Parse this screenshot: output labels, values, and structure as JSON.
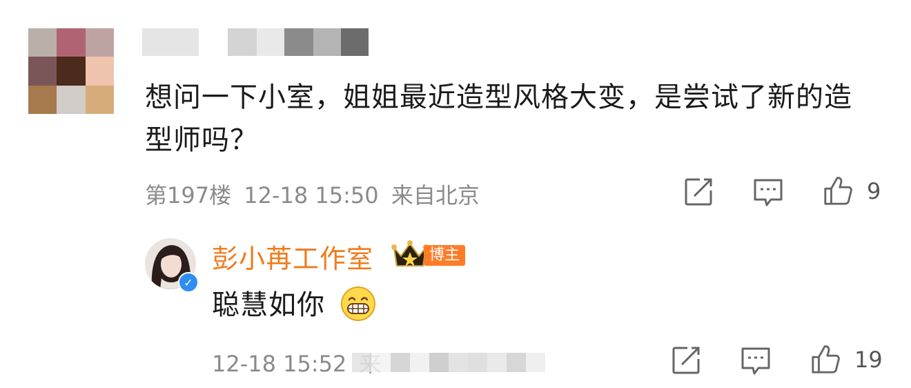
{
  "comment": {
    "text": "想问一下小室，姐姐最近造型风格大变，是尝试了新的造型师吗？",
    "floor": "第197楼",
    "time": "12-18 15:50",
    "location": "来自北京",
    "likes": "9",
    "avatar_pixels": [
      "#b9b0a8",
      "#b06373",
      "#bea3a3",
      "#7b5659",
      "#4c2a1c",
      "#efc3ae",
      "#a77a4d",
      "#d1ccc7",
      "#d7ac7b"
    ],
    "name_pixels": [
      "#e5e5e5",
      "#ffffff",
      "#d4d4d4",
      "#e9e9e9",
      "#8b8b8b",
      "#b4b4b4",
      "#6c6c6c"
    ]
  },
  "reply": {
    "author": "彭小苒工作室",
    "badge": "博主",
    "text": "聪慧如你",
    "time": "12-18 15:52",
    "location_partial": "来",
    "likes": "19",
    "location_pixels": [
      "#e2e2e2",
      "#f2f2f2",
      "#cfcfcf",
      "#eeeeee",
      "#c7c7c7",
      "#dedede",
      "#d9d9d9",
      "#e6e6e6",
      "#d0d0d0",
      "#ececec"
    ]
  },
  "colors": {
    "author_name": "#ef7b1b",
    "badge_bg": "#ff7c26",
    "meta_text": "#8a8a8a",
    "verified": "#2f8ef3"
  },
  "icons": [
    "share-icon",
    "comment-icon",
    "like-icon",
    "verified-icon",
    "crown-icon",
    "grin-emoji-icon"
  ]
}
